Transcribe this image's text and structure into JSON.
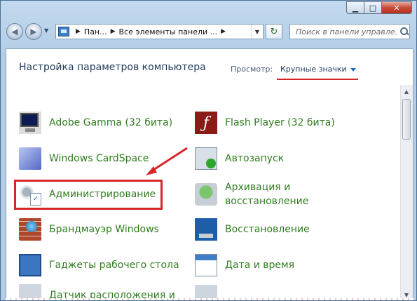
{
  "window": {
    "caption": {
      "minimize": "▁",
      "maximize": "□",
      "close": "✕"
    }
  },
  "address_bar": {
    "segments": [
      "Пан...",
      "Все элементы панели ..."
    ],
    "icon": "control-panel-icon"
  },
  "search": {
    "placeholder": "Поиск в панели управле..."
  },
  "header": {
    "title": "Настройка параметров компьютера",
    "view_by_label": "Просмотр:",
    "view_by_value": "Крупные значки"
  },
  "left_items": [
    {
      "label": "Adobe Gamma (32 бита)",
      "icon": "monitor-icon"
    },
    {
      "label": "Windows CardSpace",
      "icon": "cardspace-icon"
    },
    {
      "label": "Администрирование",
      "icon": "admin-tools-icon"
    },
    {
      "label": "Брандмауэр Windows",
      "icon": "firewall-icon"
    },
    {
      "label": "Гаджеты рабочего стола",
      "icon": "gadgets-icon"
    },
    {
      "label": "Датчик расположения и",
      "icon": "location-sensor-icon"
    }
  ],
  "right_items": [
    {
      "label": "Flash Player (32 бита)",
      "icon": "flash-icon"
    },
    {
      "label": "Автозапуск",
      "icon": "autoplay-icon"
    },
    {
      "label": "Архивация и",
      "label2": "восстановление",
      "icon": "backup-icon"
    },
    {
      "label": "Восстановление",
      "icon": "recovery-icon"
    },
    {
      "label": "Дата и время",
      "icon": "calendar-icon"
    }
  ],
  "colors": {
    "link_green": "#2f7d1f",
    "highlight_red": "#d8252a",
    "header_blue": "#1e395b"
  }
}
